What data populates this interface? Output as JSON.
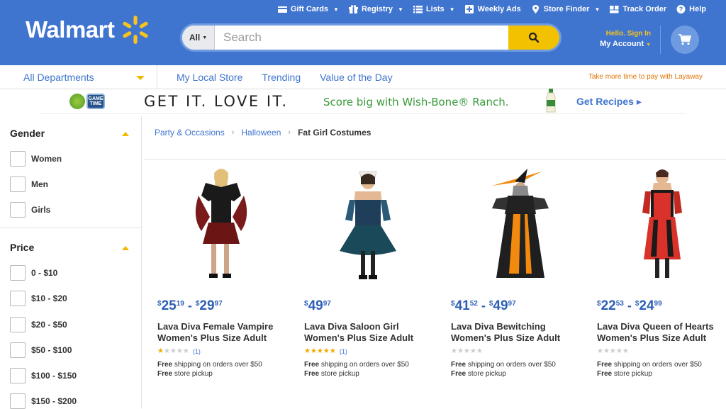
{
  "header": {
    "logo_text": "Walmart",
    "topnav": [
      {
        "label": "Gift Cards",
        "icon": "gift-card-icon",
        "caret": true
      },
      {
        "label": "Registry",
        "icon": "gift-icon",
        "caret": true
      },
      {
        "label": "Lists",
        "icon": "list-icon",
        "caret": true
      },
      {
        "label": "Weekly Ads",
        "icon": "plus-box-icon",
        "caret": false
      },
      {
        "label": "Store Finder",
        "icon": "pin-icon",
        "caret": true
      },
      {
        "label": "Track Order",
        "icon": "truck-icon",
        "caret": false
      },
      {
        "label": "Help",
        "icon": "help-icon",
        "caret": false
      }
    ],
    "search": {
      "scope": "All",
      "placeholder": "Search"
    },
    "account": {
      "hello": "Hello. Sign In",
      "my_account": "My Account"
    }
  },
  "subnav": {
    "all_departments": "All Departments",
    "links": [
      "My Local Store",
      "Trending",
      "Value of the Day"
    ],
    "layaway": "Take more time to pay with Layaway"
  },
  "banner": {
    "headline": "GET IT. LOVE IT.",
    "tagline": "Score big with Wish-Bone® Ranch.",
    "cta": "Get Recipes ▸",
    "logo2_text": "GAME TIME"
  },
  "sidebar": {
    "facets": [
      {
        "title": "Gender",
        "options": [
          "Women",
          "Men",
          "Girls"
        ]
      },
      {
        "title": "Price",
        "options": [
          "0 - $10",
          "$10 - $20",
          "$20 - $50",
          "$50 - $100",
          "$100 - $150",
          "$150 - $200"
        ]
      }
    ]
  },
  "breadcrumb": {
    "items": [
      "Party & Occasions",
      "Halloween"
    ],
    "current": "Fat Girl Costumes"
  },
  "products": [
    {
      "price_low_dollars": "25",
      "price_low_cents": "19",
      "price_high_dollars": "29",
      "price_high_cents": "97",
      "title_line1": "Lava Diva Female Vampire",
      "title_line2": "Women's Plus Size Adult",
      "stars": 1,
      "reviews": "(1)",
      "ship_bold": "Free",
      "ship_text": " shipping on orders over $50",
      "pickup_bold": "Free",
      "pickup_text": " store pickup"
    },
    {
      "price_low_dollars": "49",
      "price_low_cents": "97",
      "price_high_dollars": "",
      "price_high_cents": "",
      "title_line1": "Lava Diva Saloon Girl",
      "title_line2": "Women's Plus Size Adult",
      "stars": 5,
      "reviews": "(1)",
      "ship_bold": "Free",
      "ship_text": " shipping on orders over $50",
      "pickup_bold": "Free",
      "pickup_text": " store pickup"
    },
    {
      "price_low_dollars": "41",
      "price_low_cents": "52",
      "price_high_dollars": "49",
      "price_high_cents": "97",
      "title_line1": "Lava Diva Bewitching",
      "title_line2": "Women's Plus Size Adult",
      "stars": 0,
      "reviews": "",
      "ship_bold": "Free",
      "ship_text": " shipping on orders over $50",
      "pickup_bold": "Free",
      "pickup_text": " store pickup"
    },
    {
      "price_low_dollars": "22",
      "price_low_cents": "53",
      "price_high_dollars": "24",
      "price_high_cents": "99",
      "title_line1": "Lava Diva Queen of Hearts",
      "title_line2": "Women's Plus Size Adult",
      "stars": 0,
      "reviews": "",
      "ship_bold": "Free",
      "ship_text": " shipping on orders over $50",
      "pickup_bold": "Free",
      "pickup_text": " store pickup"
    }
  ],
  "colors": {
    "brand_blue": "#3f74cf",
    "spark_yellow": "#f7c31f",
    "search_button": "#f2c200",
    "price_blue": "#2d5fb6",
    "star": "#f2a900"
  }
}
